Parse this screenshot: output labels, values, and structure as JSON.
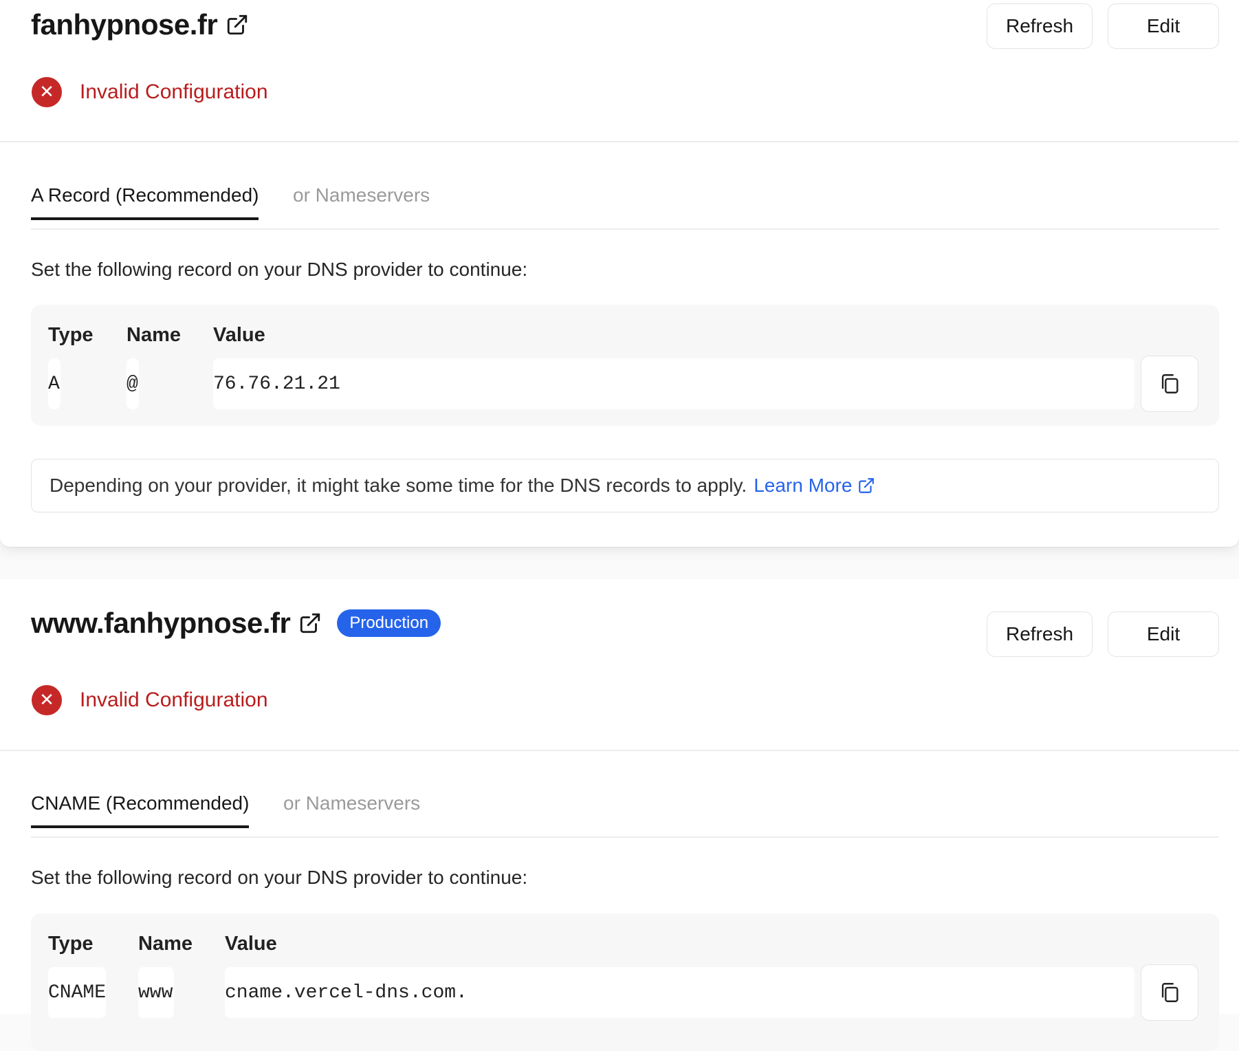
{
  "domains": [
    {
      "name": "fanhypnose.fr",
      "badge": "",
      "refresh_label": "Refresh",
      "edit_label": "Edit",
      "status": "Invalid Configuration",
      "tabs": [
        {
          "label": "A Record (Recommended)",
          "active": true
        },
        {
          "label": "or Nameservers",
          "active": false
        }
      ],
      "instruction": "Set the following record on your DNS provider to continue:",
      "record": {
        "headers": [
          "Type",
          "Name",
          "Value"
        ],
        "type": "A",
        "name": "@",
        "value": "76.76.21.21"
      },
      "note": "Depending on your provider, it might take some time for the DNS records to apply.",
      "learn_more": "Learn More"
    },
    {
      "name": "www.fanhypnose.fr",
      "badge": "Production",
      "refresh_label": "Refresh",
      "edit_label": "Edit",
      "status": "Invalid Configuration",
      "tabs": [
        {
          "label": "CNAME (Recommended)",
          "active": true
        },
        {
          "label": "or Nameservers",
          "active": false
        }
      ],
      "instruction": "Set the following record on your DNS provider to continue:",
      "record": {
        "headers": [
          "Type",
          "Name",
          "Value"
        ],
        "type": "CNAME",
        "name": "www",
        "value": "cname.vercel-dns.com."
      }
    }
  ],
  "colors": {
    "error": "#c62828",
    "link": "#2563eb",
    "badge": "#2563eb"
  }
}
